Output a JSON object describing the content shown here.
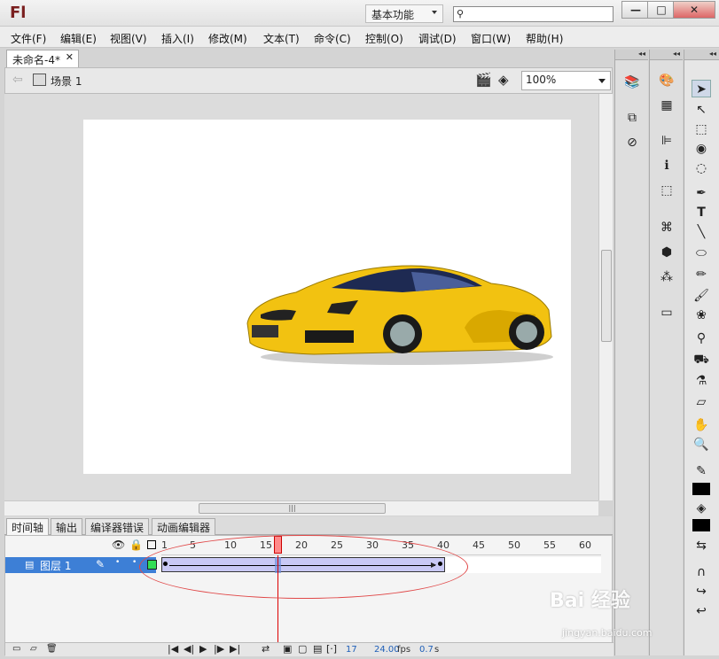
{
  "app": {
    "logo": "Fl",
    "workspace": "基本功能"
  },
  "window_buttons": {
    "minimize": "—",
    "maximize": "□",
    "close": "✕"
  },
  "menu": [
    "文件(F)",
    "编辑(E)",
    "视图(V)",
    "插入(I)",
    "修改(M)",
    "文本(T)",
    "命令(C)",
    "控制(O)",
    "调试(D)",
    "窗口(W)",
    "帮助(H)"
  ],
  "document": {
    "tab_title": "未命名-4*",
    "scene": "场景 1",
    "zoom": "100%"
  },
  "stage": {
    "background": "#ffffff",
    "image": "yellow-sports-car"
  },
  "panel_tabs": [
    "时间轴",
    "输出",
    "编译器错误",
    "动画编辑器"
  ],
  "timeline": {
    "ruler": [
      "1",
      "5",
      "10",
      "15",
      "20",
      "25",
      "30",
      "35",
      "40",
      "45",
      "50",
      "55",
      "60"
    ],
    "layer_name": "图层 1",
    "current_frame": "17",
    "fps": "24.00",
    "fps_unit": "fps",
    "elapsed": "0.7",
    "elapsed_unit": "s",
    "tween_end_frame": 40
  },
  "watermark": {
    "text": "Bai 经验",
    "url": "jingyan.baidu.com"
  },
  "colors": {
    "selected_layer": "#3d7fd6",
    "tween": "#c9c9f5",
    "playhead": "#ff8a8a",
    "annotation": "#e04848"
  }
}
